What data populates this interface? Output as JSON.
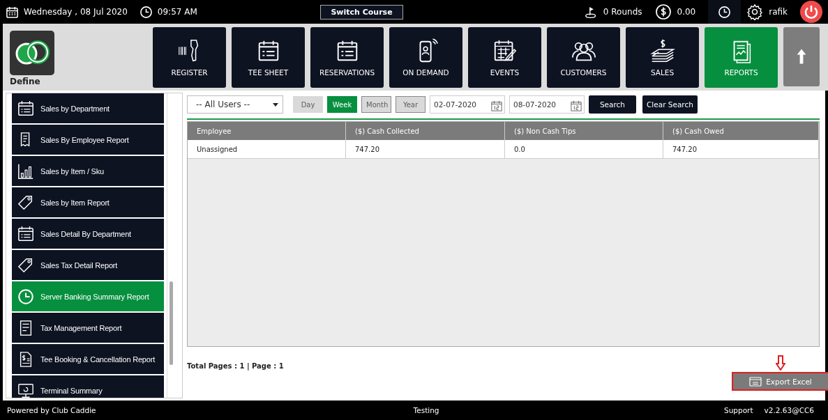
{
  "top_bar": {
    "date": "Wednesday ,  08 Jul 2020",
    "time": "09:57 AM",
    "switch_button": "Switch Course",
    "rounds": "0 Rounds",
    "balance": "0.00",
    "user": "rafik"
  },
  "logo": {
    "label": "Define"
  },
  "nav": [
    {
      "label": "REGISTER",
      "selected": false
    },
    {
      "label": "TEE SHEET",
      "selected": false
    },
    {
      "label": "RESERVATIONS",
      "selected": false
    },
    {
      "label": "ON DEMAND",
      "selected": false
    },
    {
      "label": "EVENTS",
      "selected": false
    },
    {
      "label": "CUSTOMERS",
      "selected": false
    },
    {
      "label": "SALES",
      "selected": false
    },
    {
      "label": "REPORTS",
      "selected": true
    }
  ],
  "sidebar": {
    "items": [
      {
        "label": "Sales by Department",
        "selected": false
      },
      {
        "label": "Sales By Employee Report",
        "selected": false
      },
      {
        "label": "Sales by Item / Sku",
        "selected": false
      },
      {
        "label": "Sales by Item Report",
        "selected": false
      },
      {
        "label": "Sales Detail By Department",
        "selected": false
      },
      {
        "label": "Sales Tax Detail Report",
        "selected": false
      },
      {
        "label": "Server Banking Summary Report",
        "selected": true
      },
      {
        "label": "Tax Management Report",
        "selected": false
      },
      {
        "label": "Tee Booking & Cancellation Report",
        "selected": false
      },
      {
        "label": "Terminal Summary",
        "selected": false
      }
    ]
  },
  "filters": {
    "user_select": "-- All Users --",
    "periods": [
      {
        "label": "Day",
        "selected": false
      },
      {
        "label": "Week",
        "selected": true
      },
      {
        "label": "Month",
        "selected": false
      },
      {
        "label": "Year",
        "selected": false
      }
    ],
    "from_date": "02-07-2020",
    "to_date": "08-07-2020",
    "search_button": "Search",
    "clear_button": "Clear Search"
  },
  "table": {
    "columns": [
      "Employee",
      "($) Cash Collected",
      "($) Non Cash Tips",
      "($) Cash Owed"
    ],
    "rows": [
      [
        "Unassigned",
        "747.20",
        "0.0",
        "747.20"
      ]
    ]
  },
  "pagination": "Total Pages : 1 | Page : 1",
  "export_button": {
    "label": "Export Excel",
    "highlighted": true
  },
  "footer": {
    "left": "Powered by Club Caddie",
    "center": "Testing",
    "support": "Support",
    "version": "v2.2.63@CC6"
  }
}
